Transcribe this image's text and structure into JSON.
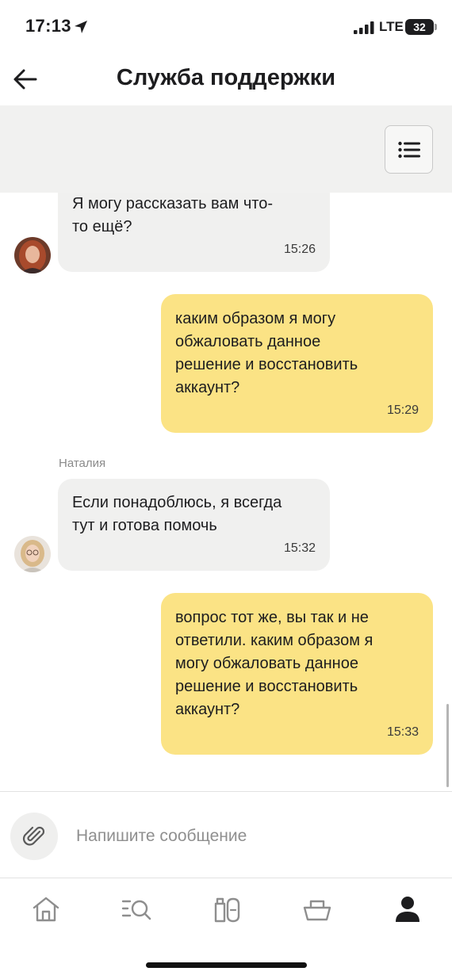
{
  "status_bar": {
    "time": "17:13",
    "network": "LTE",
    "battery": "32"
  },
  "header": {
    "title": "Служба поддержки"
  },
  "messages": [
    {
      "direction": "incoming",
      "text": "Я могу рассказать вам что-\nто ещё?",
      "time": "15:26"
    },
    {
      "direction": "outgoing",
      "text": "каким образом я могу\nобжаловать данное\nрешение и восстановить\nаккаунт?",
      "time": "15:29"
    },
    {
      "direction": "incoming",
      "sender": "Наталия",
      "text": "Если понадоблюсь, я всегда\nтут и готова помочь",
      "time": "15:32"
    },
    {
      "direction": "outgoing",
      "text": "вопрос тот же, вы так и не\nответили. каким образом я\nмогу обжаловать данное\nрешение и восстановить\nаккаунт?",
      "time": "15:33"
    }
  ],
  "composer": {
    "placeholder": "Напишите сообщение",
    "value": ""
  },
  "nav": {
    "items": [
      "home-icon",
      "catalog-search-icon",
      "products-icon",
      "basket-icon",
      "profile-icon"
    ],
    "active": "profile-icon"
  },
  "colors": {
    "outgoing_bubble": "#fbe385",
    "incoming_bubble": "#f0f0ef",
    "panel": "#f1f1f0"
  }
}
